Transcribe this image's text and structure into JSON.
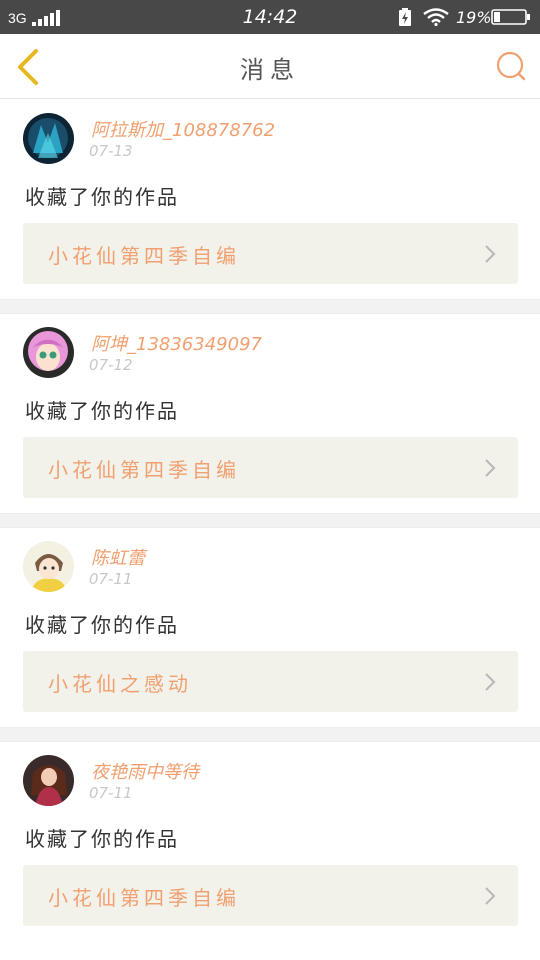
{
  "status_bar": {
    "network": "3G",
    "time": "14:42",
    "battery": "19%"
  },
  "nav": {
    "title": "消息",
    "back_icon": "chevron-left-icon",
    "search_icon": "search-icon",
    "accent_color": "#f0a070",
    "back_color": "#e8b820"
  },
  "messages": [
    {
      "username": "阿拉斯加_108878762",
      "date": "07-13",
      "action": "收藏了你的作品",
      "work": "小花仙第四季自编"
    },
    {
      "username": "阿坤_13836349097",
      "date": "07-12",
      "action": "收藏了你的作品",
      "work": "小花仙第四季自编"
    },
    {
      "username": "陈虹蕾",
      "date": "07-11",
      "action": "收藏了你的作品",
      "work": "小花仙之感动"
    },
    {
      "username": "夜艳雨中等待",
      "date": "07-11",
      "action": "收藏了你的作品",
      "work": "小花仙第四季自编"
    }
  ]
}
